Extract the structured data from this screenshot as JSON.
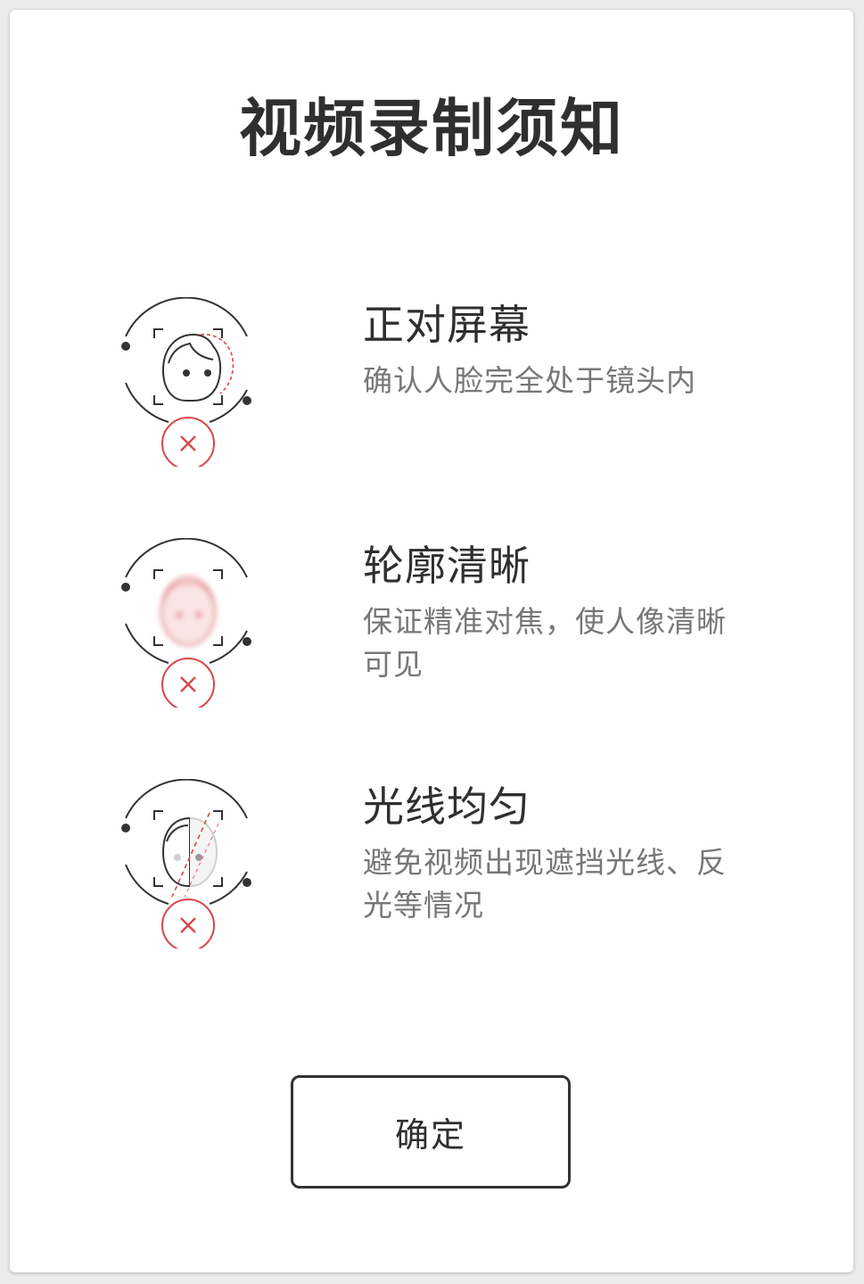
{
  "dialog": {
    "title": "视频录制须知",
    "confirm_label": "确定"
  },
  "tips": [
    {
      "heading": "正对屏幕",
      "description": "确认人脸完全处于镜头内",
      "icon": "face-not-centered-icon"
    },
    {
      "heading": "轮廓清晰",
      "description": "保证精准对焦，使人像清晰可见",
      "icon": "face-blurry-icon"
    },
    {
      "heading": "光线均匀",
      "description": "避免视频出现遮挡光线、反光等情况",
      "icon": "face-uneven-light-icon"
    }
  ],
  "colors": {
    "accent_red": "#d9474b",
    "text_dark": "#2f2f2f",
    "text_muted": "#777777",
    "line": "#333333"
  }
}
